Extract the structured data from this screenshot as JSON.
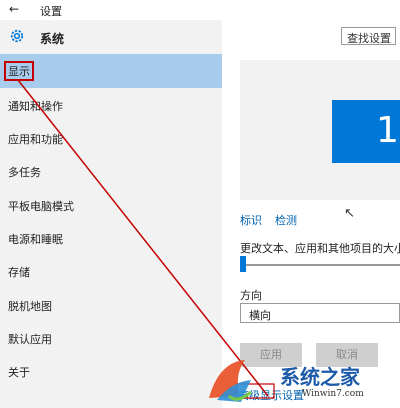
{
  "window": {
    "title": "设置"
  },
  "header": {
    "section_title": "系统",
    "search_placeholder": "查找设置"
  },
  "sidebar": {
    "items": [
      {
        "label": "显示",
        "active": true
      },
      {
        "label": "通知和操作"
      },
      {
        "label": "应用和功能"
      },
      {
        "label": "多任务"
      },
      {
        "label": "平板电脑模式"
      },
      {
        "label": "电源和睡眠"
      },
      {
        "label": "存储"
      },
      {
        "label": "脱机地图"
      },
      {
        "label": "默认应用"
      },
      {
        "label": "关于"
      }
    ]
  },
  "main": {
    "monitor_number": "1",
    "identify_link": "标识",
    "detect_link": "检测",
    "scale_label": "更改文本、应用和其他项目的大小:",
    "scale_value": 0,
    "orientation_label": "方向",
    "orientation_value": "横向",
    "apply_button": "应用",
    "cancel_button": "取消",
    "advanced_link": "高级显示设置"
  },
  "watermark": {
    "brand": "系统之家",
    "url": "Winwin7.com"
  },
  "colors": {
    "accent": "#0078d7",
    "selection": "#a8cdec",
    "annotation": "#c40000"
  }
}
